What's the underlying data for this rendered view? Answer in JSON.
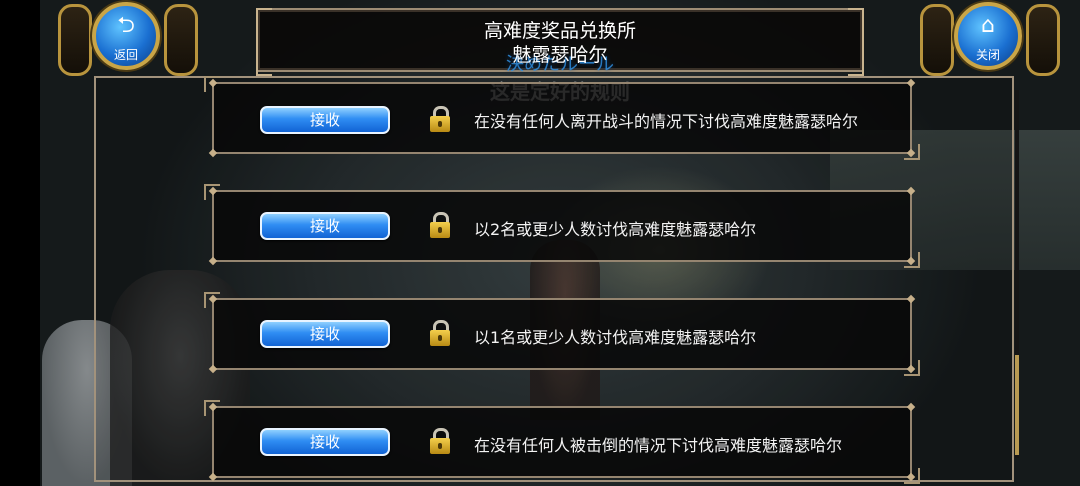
{
  "header": {
    "title_line1": "高难度奖品兑换所",
    "title_line2": "魅露瑟哈尔",
    "title_overlay": "決めたルール",
    "subtitle": "这是定好的规则"
  },
  "back_button": {
    "label": "返回",
    "icon": "return-arrow-icon"
  },
  "close_button": {
    "label": "关闭",
    "icon": "home-icon"
  },
  "rows": [
    {
      "button_label": "接收",
      "locked": true,
      "condition": "在没有任何人离开战斗的情况下讨伐高难度魅露瑟哈尔"
    },
    {
      "button_label": "接收",
      "locked": true,
      "condition": "以2名或更少人数讨伐高难度魅露瑟哈尔"
    },
    {
      "button_label": "接收",
      "locked": true,
      "condition": "以1名或更少人数讨伐高难度魅露瑟哈尔"
    },
    {
      "button_label": "接收",
      "locked": true,
      "condition": "在没有任何人被击倒的情况下讨伐高难度魅露瑟哈尔"
    }
  ],
  "colors": {
    "button_blue": "#2f8df3",
    "frame_gold": "#b8943d",
    "panel_border": "#a2927c",
    "lock_gold": "#f4cf4c"
  }
}
